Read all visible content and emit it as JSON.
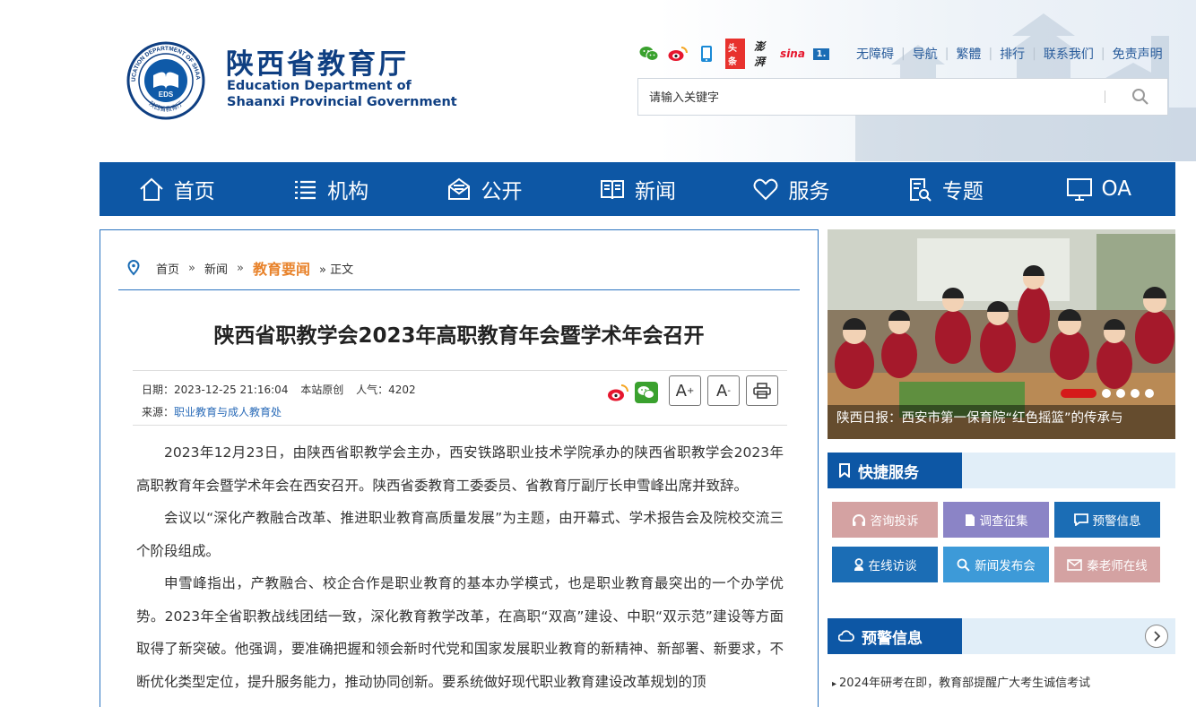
{
  "header": {
    "title_cn": "陕西省教育厅",
    "title_en_line1": "Education Department of",
    "title_en_line2": "Shaanxi Provincial Government",
    "seal_text_en": "EDUCATION DEPARTMENT OF SHAANXI",
    "seal_text_cn": "陕西省教育厅",
    "seal_center": "EDS",
    "icons": [
      "wechat-icon",
      "weibo-icon",
      "mobile-icon",
      "toutiao-icon",
      "thepaper-icon",
      "sina-icon",
      "yidian-icon"
    ],
    "icon_labels": {
      "toutiao": "头条",
      "thepaper": "澎湃",
      "sina": "sina",
      "yidian": "1."
    },
    "links": [
      "无障碍",
      "导航",
      "繁體",
      "排行",
      "联系我们",
      "免责声明"
    ],
    "search_placeholder": "请输入关键字"
  },
  "nav": [
    {
      "label": "首页",
      "icon": "home-icon"
    },
    {
      "label": "机构",
      "icon": "list-icon"
    },
    {
      "label": "公开",
      "icon": "mail-open-icon"
    },
    {
      "label": "新闻",
      "icon": "book-icon"
    },
    {
      "label": "服务",
      "icon": "heart-icon"
    },
    {
      "label": "专题",
      "icon": "document-search-icon"
    },
    {
      "label": "OA",
      "icon": "monitor-icon"
    }
  ],
  "breadcrumb": {
    "home": "首页",
    "news": "新闻",
    "current": "教育要闻",
    "tail": "» 正文",
    "sep": "»"
  },
  "article": {
    "title": "陕西省职教学会2023年高职教育年会暨学术年会召开",
    "date": "日期：2023-12-25 21:16:04",
    "origin": "本站原创",
    "views": "人气：4202",
    "source_label": "来源：",
    "source": "职业教育与成人教育处",
    "font_increase": "A",
    "font_decrease": "A",
    "paragraphs": [
      "2023年12月23日，由陕西省职教学会主办，西安铁路职业技术学院承办的陕西省职教学会2023年高职教育年会暨学术年会在西安召开。陕西省委教育工委委员、省教育厅副厅长申雪峰出席并致辞。",
      "会议以“深化产教融合改革、推进职业教育高质量发展”为主题，由开幕式、学术报告会及院校交流三个阶段组成。",
      "申雪峰指出，产教融合、校企合作是职业教育的基本办学模式，也是职业教育最突出的一个办学优势。2023年全省职教战线团结一致，深化教育教学改革，在高职“双高”建设、中职“双示范”建设等方面取得了新突破。他强调，要准确把握和领会新时代党和国家发展职业教育的新精神、新部署、新要求，不断优化类型定位，提升服务能力，推动协同创新。要系统做好现代职业教育建设改革规划的顶"
    ]
  },
  "slider": {
    "caption": "陕西日报：西安市第一保育院“红色摇篮”的传承与",
    "dots": 5,
    "active_dot": 0
  },
  "quick_service": {
    "title": "快捷服务",
    "buttons": [
      {
        "label": "咨询投诉",
        "color": "#d4a2a2",
        "icon": "headset-icon"
      },
      {
        "label": "调查征集",
        "color": "#8b84c6",
        "icon": "file-icon"
      },
      {
        "label": "预警信息",
        "color": "#1b6db5",
        "icon": "chat-icon"
      },
      {
        "label": "在线访谈",
        "color": "#1b6db5",
        "icon": "user-icon"
      },
      {
        "label": "新闻发布会",
        "color": "#3d9ad8",
        "icon": "search-icon"
      },
      {
        "label": "秦老师在线",
        "color": "#d4a2a2",
        "icon": "envelope-icon"
      }
    ]
  },
  "alerts": {
    "title": "预警信息",
    "items": [
      "2024年研考在即，教育部提醒广大考生诚信考试"
    ]
  },
  "colors": {
    "brand_blue": "#0d57a5",
    "accent_orange": "#e8822a",
    "link_blue": "#2a6bb8"
  }
}
